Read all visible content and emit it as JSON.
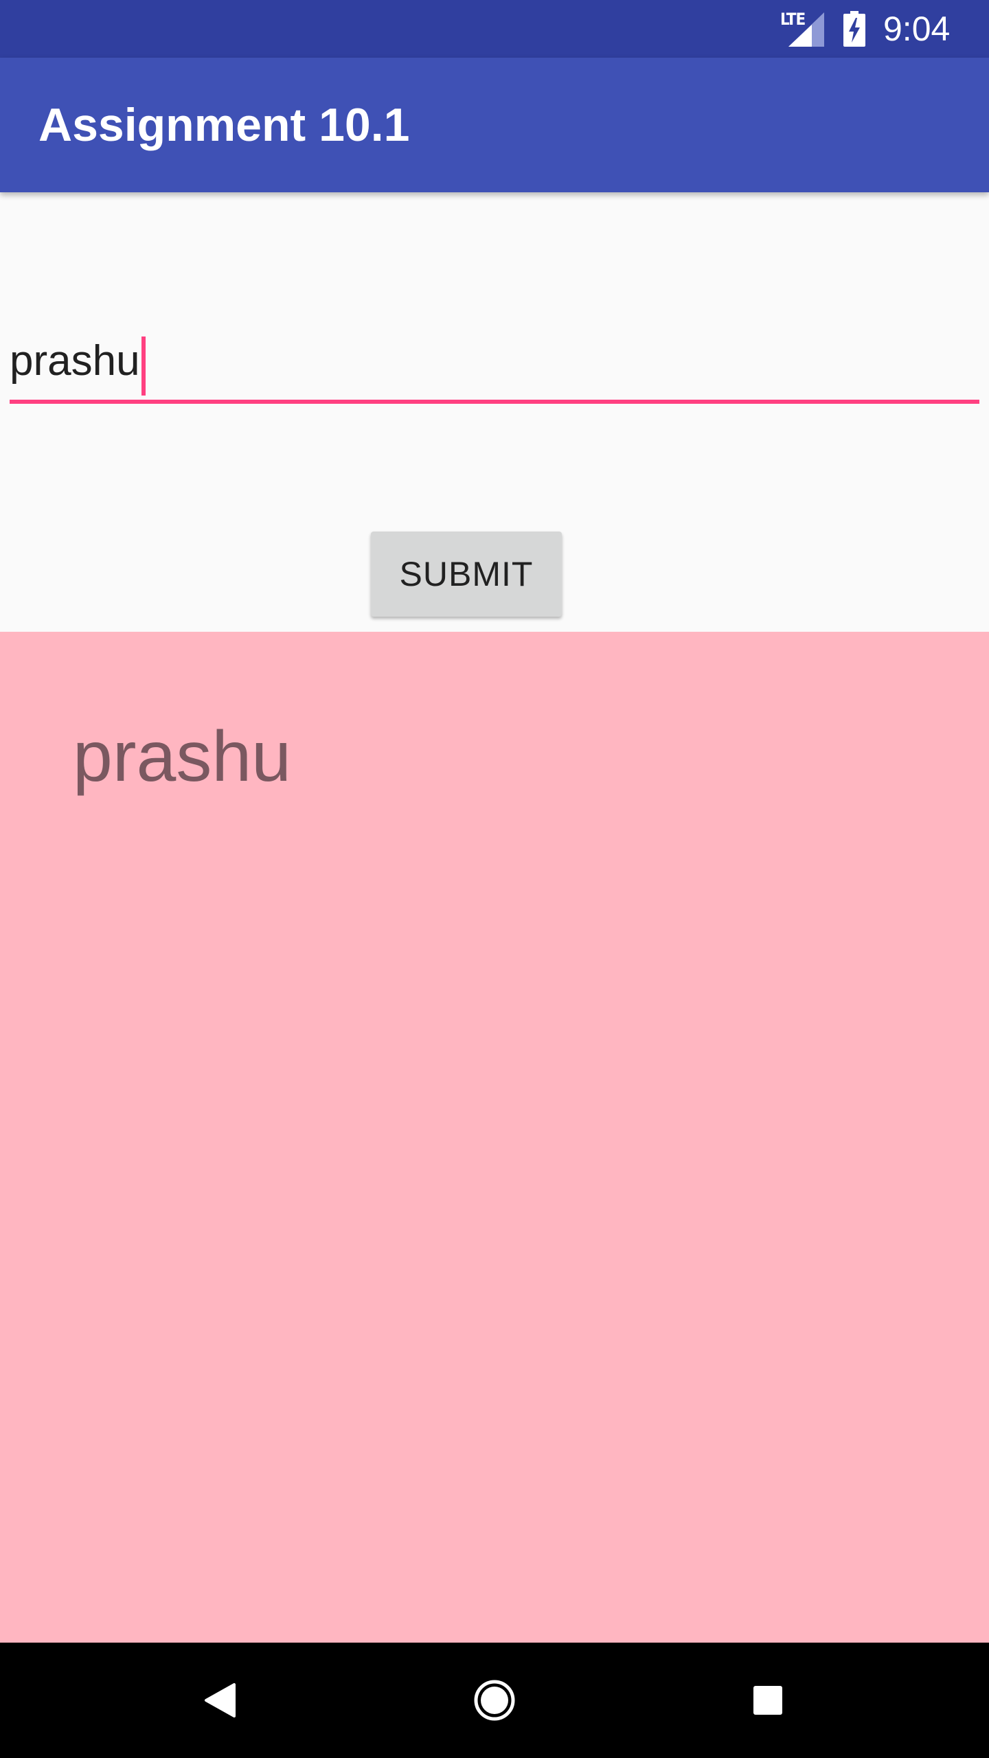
{
  "status_bar": {
    "network_label": "LTE",
    "time": "9:04",
    "icons": [
      "lte-signal-icon",
      "battery-charging-icon"
    ],
    "background_color": "#303F9F"
  },
  "app_bar": {
    "title": "Assignment 10.1",
    "background_color": "#3F51B5"
  },
  "form": {
    "input_value": "prashu",
    "accent_color": "#FF4081",
    "submit_label": "SUBMIT"
  },
  "output": {
    "text": "prashu",
    "background_color": "#FFB6C1"
  },
  "nav_bar": {
    "icons": [
      "back-icon",
      "home-icon",
      "recents-icon"
    ]
  }
}
